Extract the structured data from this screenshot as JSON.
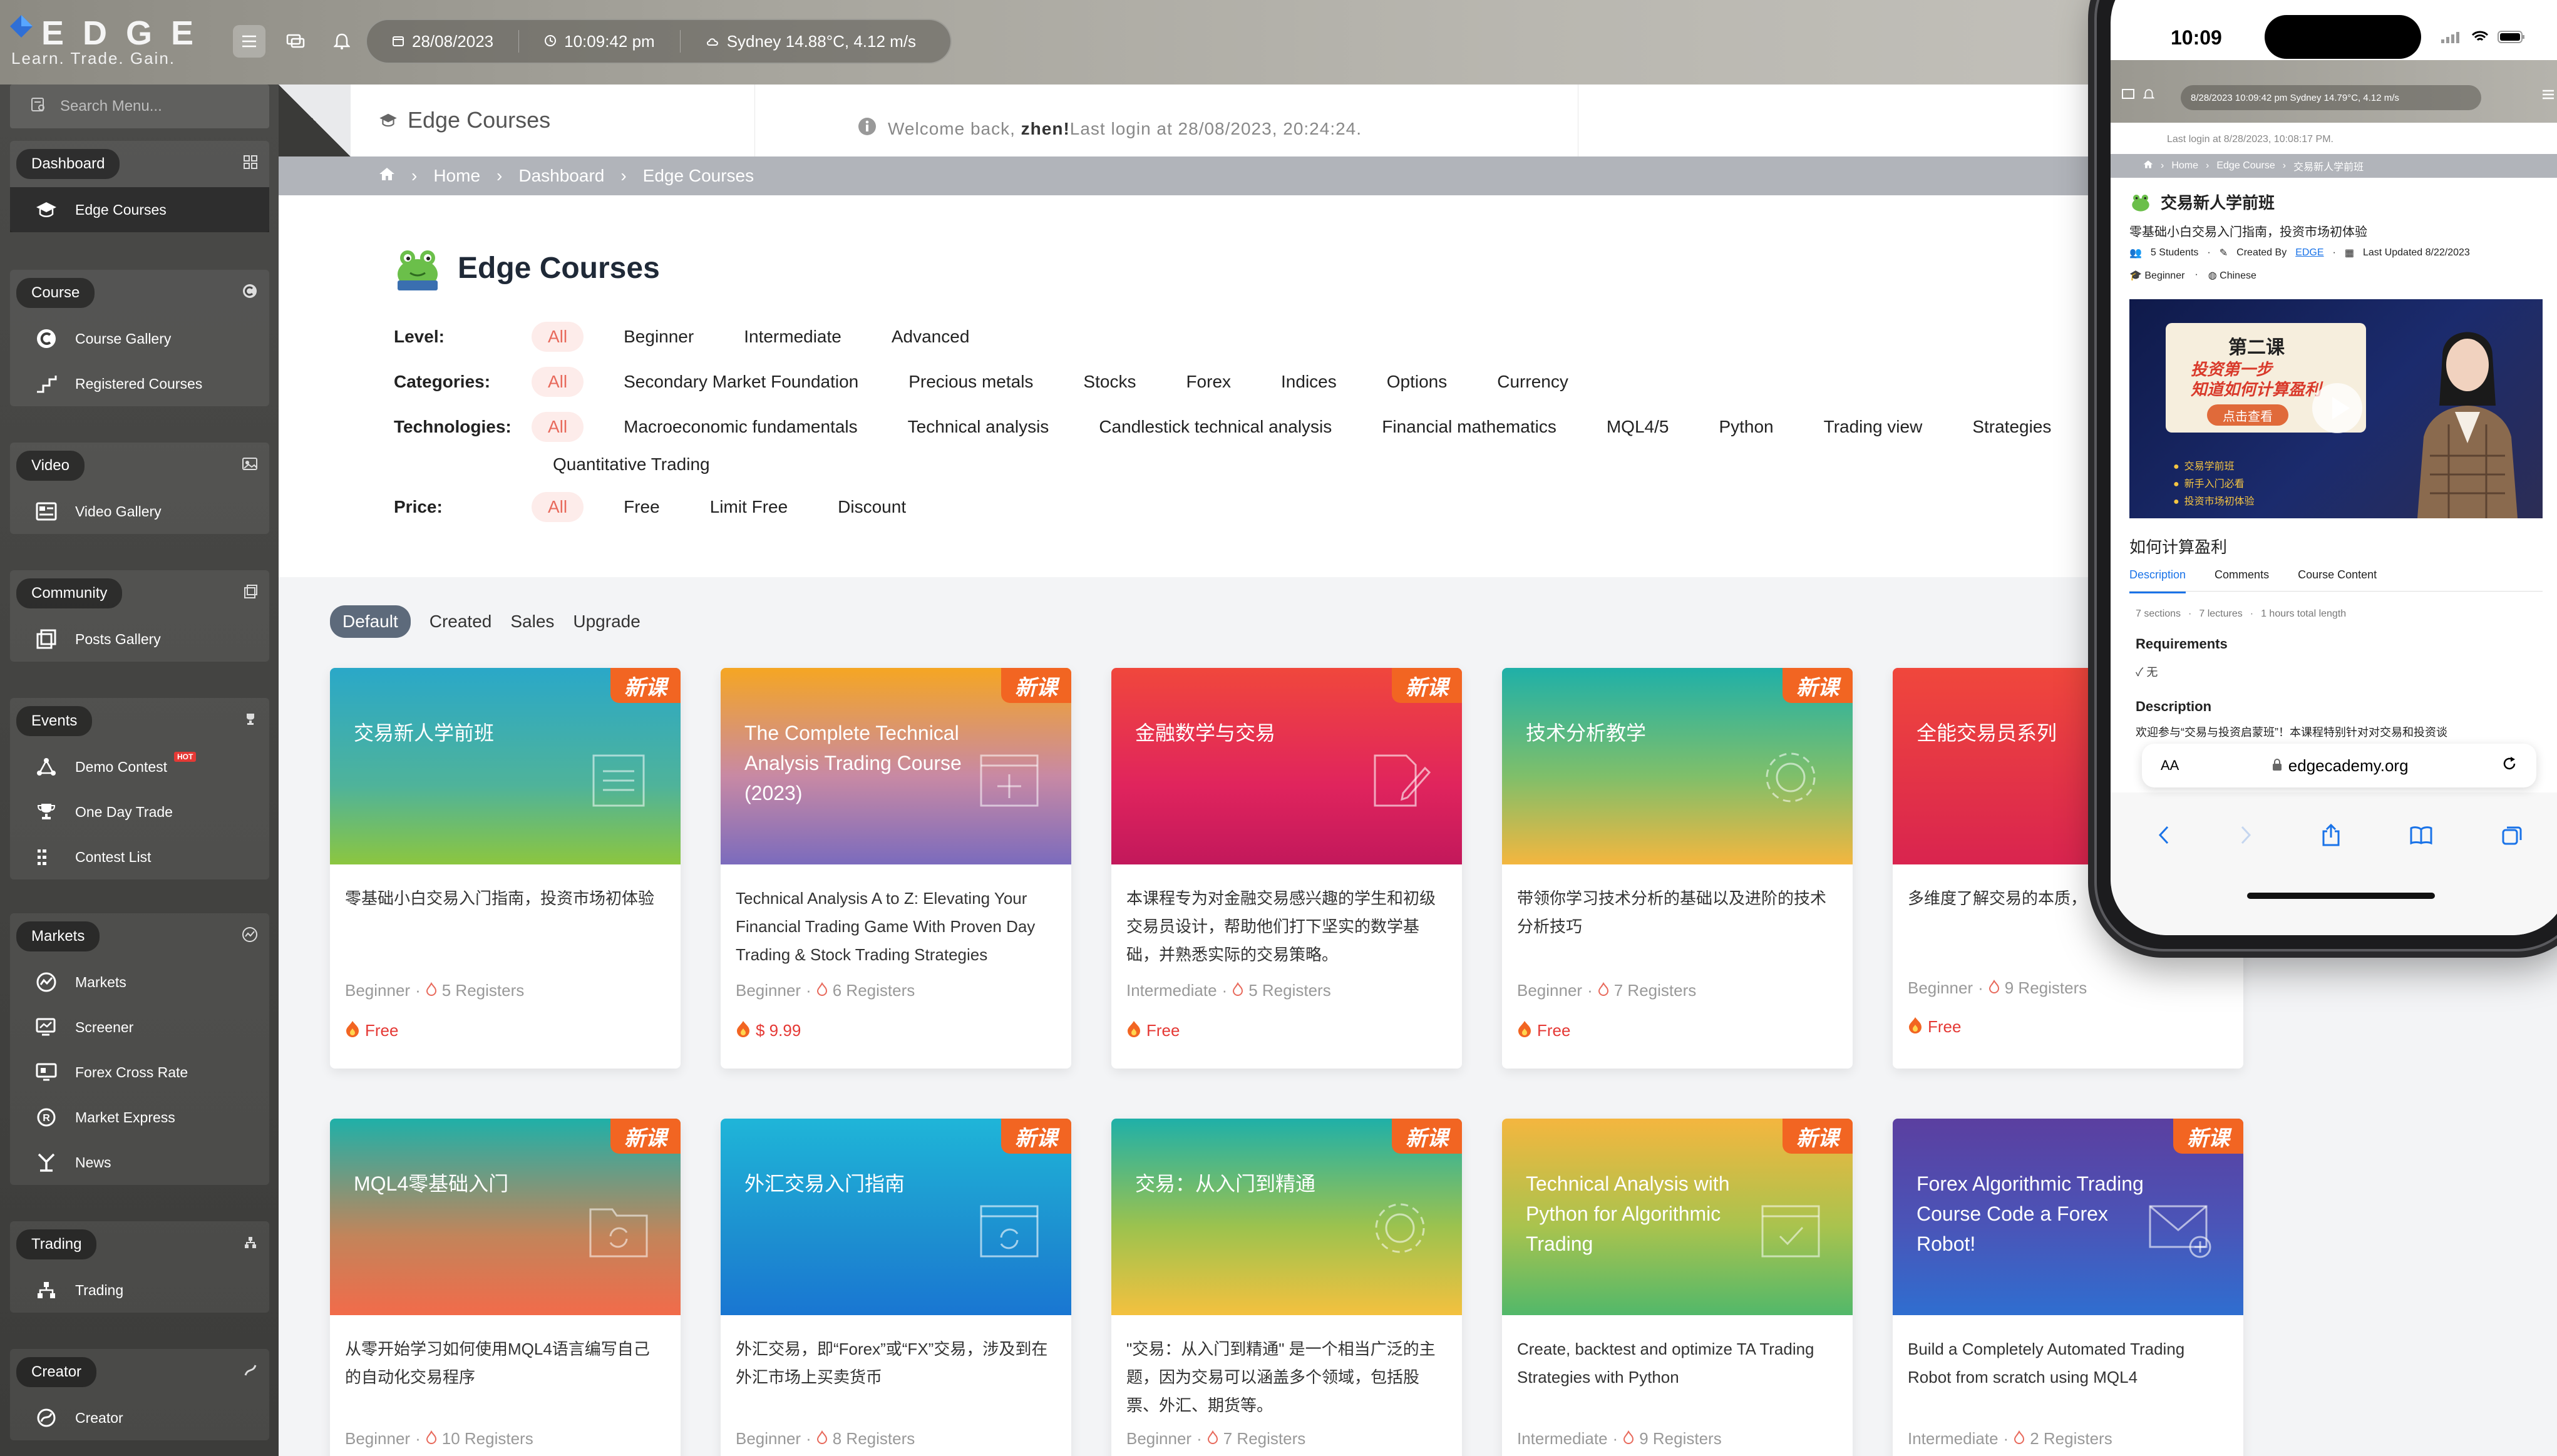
{
  "app": {
    "logo_text": "EDGE",
    "tagline": "Learn. Trade. Gain.",
    "date": "28/08/2023",
    "time": "10:09:42 pm",
    "weather": "Sydney 14.88°C, 4.12 m/s",
    "search_placeholder": "Search Menu..."
  },
  "sidebar": {
    "groups": [
      {
        "title": "Dashboard",
        "items": [
          {
            "label": "Edge Courses"
          }
        ]
      },
      {
        "title": "Course",
        "items": [
          {
            "label": "Course Gallery"
          },
          {
            "label": "Registered Courses"
          }
        ]
      },
      {
        "title": "Video",
        "items": [
          {
            "label": "Video Gallery"
          }
        ]
      },
      {
        "title": "Community",
        "items": [
          {
            "label": "Posts Gallery"
          }
        ]
      },
      {
        "title": "Events",
        "items": [
          {
            "label": "Demo Contest",
            "badge": "HOT"
          },
          {
            "label": "One Day Trade"
          },
          {
            "label": "Contest List"
          }
        ]
      },
      {
        "title": "Markets",
        "items": [
          {
            "label": "Markets"
          },
          {
            "label": "Screener"
          },
          {
            "label": "Forex Cross Rate"
          },
          {
            "label": "Market Express"
          },
          {
            "label": "News"
          }
        ]
      },
      {
        "title": "Trading",
        "items": [
          {
            "label": "Trading"
          }
        ]
      },
      {
        "title": "Creator",
        "items": [
          {
            "label": "Creator"
          }
        ]
      }
    ]
  },
  "header": {
    "title": "Edge Courses",
    "welcome_prefix": "Welcome back, ",
    "username": "zhen!",
    "last_login": "Last login at 28/08/2023, 20:24:24."
  },
  "breadcrumb": [
    "Home",
    "Dashboard",
    "Edge Courses"
  ],
  "filters": {
    "heading": "Edge Courses",
    "level": {
      "label": "Level:",
      "options": [
        "All",
        "Beginner",
        "Intermediate",
        "Advanced"
      ]
    },
    "categories": {
      "label": "Categories:",
      "options": [
        "All",
        "Secondary Market Foundation",
        "Precious metals",
        "Stocks",
        "Forex",
        "Indices",
        "Options",
        "Currency"
      ]
    },
    "technologies": {
      "label": "Technologies:",
      "options": [
        "All",
        "Macroeconomic fundamentals",
        "Technical analysis",
        "Candlestick technical analysis",
        "Financial mathematics",
        "MQL4/5",
        "Python",
        "Trading view",
        "Strategies",
        "Quantitative Trading"
      ]
    },
    "price": {
      "label": "Price:",
      "options": [
        "All",
        "Free",
        "Limit Free",
        "Discount"
      ]
    }
  },
  "sort_tabs": [
    "Default",
    "Created",
    "Sales",
    "Upgrade"
  ],
  "badge_text": "新课",
  "courses": [
    {
      "title": "交易新人学前班",
      "desc": "零基础小白交易入门指南，投资市场初体验",
      "level": "Beginner",
      "registers": "5 Registers",
      "price": "Free"
    },
    {
      "title": "The Complete Technical Analysis Trading Course (2023)",
      "desc": "Technical Analysis A to Z: Elevating Your Financial Trading Game With Proven Day Trading & Stock Trading Strategies",
      "level": "Beginner",
      "registers": "6 Registers",
      "price": "$ 9.99"
    },
    {
      "title": "金融数学与交易",
      "desc": "本课程专为对金融交易感兴趣的学生和初级交易员设计，帮助他们打下坚实的数学基础，并熟悉实际的交易策略。",
      "level": "Intermediate",
      "registers": "5 Registers",
      "price": "Free"
    },
    {
      "title": "技术分析教学",
      "desc": "带领你学习技术分析的基础以及进阶的技术分析技巧",
      "level": "Beginner",
      "registers": "7 Registers",
      "price": "Free"
    },
    {
      "title": "全能交易员系列",
      "desc": "多维度了解交易的本质，",
      "level": "Beginner",
      "registers": "9 Registers",
      "price": "Free"
    },
    {
      "title": "MQL4零基础入门",
      "desc": "从零开始学习如何使用MQL4语言编写自己的自动化交易程序",
      "level": "Beginner",
      "registers": "10 Registers",
      "price": ""
    },
    {
      "title": "外汇交易入门指南",
      "desc": "外汇交易，即“Forex”或“FX”交易，涉及到在外汇市场上买卖货币",
      "level": "Beginner",
      "registers": "8 Registers",
      "price": ""
    },
    {
      "title": "交易：从入门到精通",
      "desc": "\"交易：从入门到精通\" 是一个相当广泛的主题，因为交易可以涵盖多个领域，包括股票、外汇、期货等。",
      "level": "Beginner",
      "registers": "7 Registers",
      "price": ""
    },
    {
      "title": "Technical Analysis with Python for Algorithmic Trading",
      "desc": "Create, backtest and optimize TA Trading Strategies with Python",
      "level": "Intermediate",
      "registers": "9 Registers",
      "price": ""
    },
    {
      "title": "Forex Algorithmic Trading Course Code a Forex Robot!",
      "desc": "Build a Completely Automated Trading Robot from scratch using MQL4",
      "level": "Intermediate",
      "registers": "2 Registers",
      "price": ""
    }
  ],
  "phone": {
    "clock": "10:09",
    "info": "8/28/2023   10:09:42 pm   Sydney 14.79°C, 4.12 m/s",
    "last_login": "Last login at 8/28/2023, 10:08:17 PM.",
    "breadcrumb": [
      "Home",
      "Edge Course",
      "交易新人学前班"
    ],
    "course_title": "交易新人学前班",
    "subtitle": "零基础小白交易入门指南，投资市场初体验",
    "students": "5 Students",
    "created_by_prefix": "Created By",
    "creator": "EDGE",
    "updated": "Last Updated 8/22/2023",
    "level": "Beginner",
    "language": "Chinese",
    "video": {
      "line1": "第二课",
      "line2": "投资第一步",
      "line3": "知道如何计算盈利",
      "button": "点击查看",
      "bullets": [
        "交易学前班",
        "新手入门必看",
        "投资市场初体验"
      ]
    },
    "lesson_title": "如何计算盈利",
    "tabs": [
      "Description",
      "Comments",
      "Course Content"
    ],
    "stats": [
      "7 sections",
      "7 lectures",
      "1 hours total length"
    ],
    "requirements_heading": "Requirements",
    "requirement": "无",
    "description_heading": "Description",
    "description": "欢迎参与“交易与投资启蒙班”！本课程特别针对对交易和投资谈",
    "url_aa": "AA",
    "url": "edgecademy.org"
  },
  "colors": {
    "accent": "#e86a5c",
    "badge": "#f26522",
    "link": "#1a73e8"
  }
}
